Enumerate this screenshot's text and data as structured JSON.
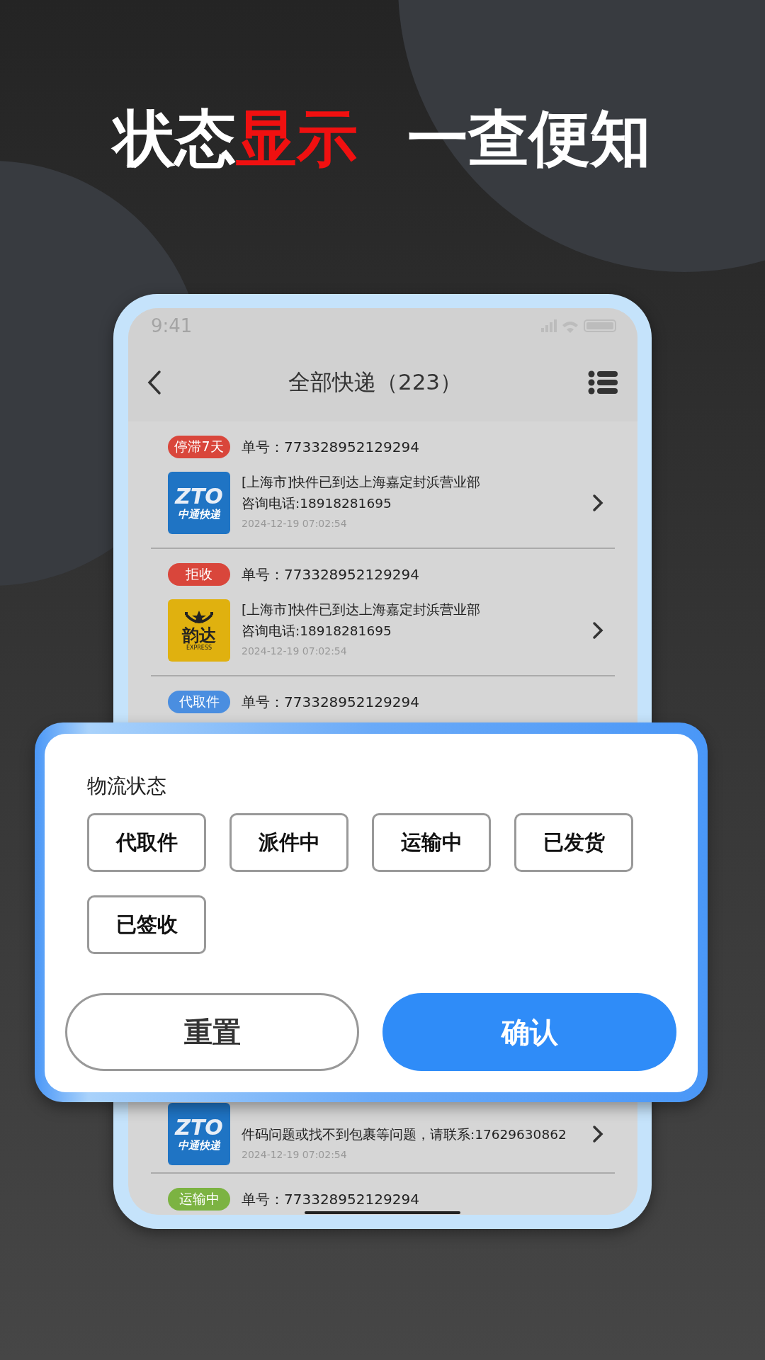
{
  "headline": {
    "parts": [
      {
        "text": "状态",
        "highlight": false
      },
      {
        "text": "显示",
        "highlight": true
      }
    ],
    "tail": "一查便知"
  },
  "phone": {
    "status_bar": {
      "time": "9:41"
    },
    "nav": {
      "title": "全部快递（223）"
    },
    "items": [
      {
        "kind": "full",
        "badge": {
          "text": "停滞7天",
          "color": "#d9463b"
        },
        "number": "单号：773328952129294",
        "logo": {
          "kind": "zto",
          "mark": "ZTO",
          "name": "中通快递"
        },
        "lines": [
          "[上海市]快件已到达上海嘉定封浜营业部",
          "咨询电话:18918281695"
        ],
        "date": "2024-12-19  07:02:54"
      },
      {
        "kind": "full",
        "badge": {
          "text": "拒收",
          "color": "#d9463b"
        },
        "number": "单号：773328952129294",
        "logo": {
          "kind": "yunda",
          "mark": "韵达",
          "name": "EXPRESS"
        },
        "lines": [
          "[上海市]快件已到达上海嘉定封浜营业部",
          "咨询电话:18918281695"
        ],
        "date": "2024-12-19  07:02:54"
      },
      {
        "kind": "head",
        "badge": {
          "text": "代取件",
          "color": "#4a8ee0"
        },
        "number": "单号：773328952129294"
      },
      {
        "kind": "body",
        "logo": {
          "kind": "zto",
          "mark": "ZTO",
          "name": "中通快递"
        },
        "lines": [
          "件码问题或找不到包裹等问题，请联系:17629630862"
        ],
        "date": "2024-12-19  07:02:54"
      },
      {
        "kind": "head",
        "badge": {
          "text": "运输中",
          "color": "#7cb342"
        },
        "number": "单号：773328952129294"
      }
    ]
  },
  "dialog": {
    "title": "物流状态",
    "options": [
      {
        "label": "代取件",
        "selected": false
      },
      {
        "label": "派件中",
        "selected": false
      },
      {
        "label": "运输中",
        "selected": false
      },
      {
        "label": "已发货",
        "selected": false
      },
      {
        "label": "已签收",
        "selected": false
      }
    ],
    "buttons": [
      {
        "kind": "secondary",
        "label": "重置"
      },
      {
        "kind": "primary",
        "label": "确认"
      }
    ]
  }
}
